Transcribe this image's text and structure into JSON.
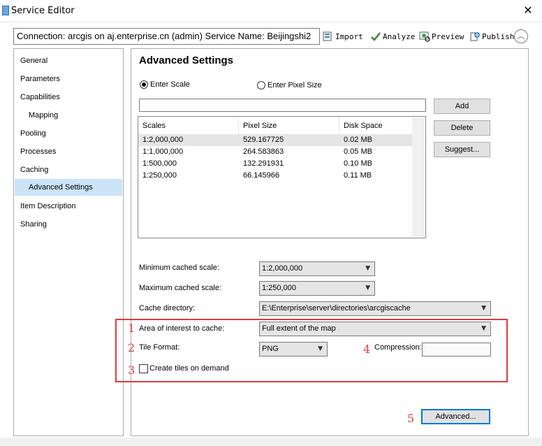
{
  "window": {
    "title": "Service Editor",
    "close_glyph": "✕"
  },
  "toolbar": {
    "connection_text": "Connection: arcgis on aj.enterprise.cn (admin)   Service Name: Beijingshi2",
    "import_label": "Import",
    "analyze_label": "Analyze",
    "preview_label": "Preview",
    "publish_label": "Publish",
    "collapse_glyph": "︿"
  },
  "sidebar": {
    "items": [
      {
        "label": "General"
      },
      {
        "label": "Parameters"
      },
      {
        "label": "Capabilities"
      },
      {
        "label": "Mapping"
      },
      {
        "label": "Pooling"
      },
      {
        "label": "Processes"
      },
      {
        "label": "Caching"
      },
      {
        "label": "Advanced Settings"
      },
      {
        "label": "Item Description"
      },
      {
        "label": "Sharing"
      }
    ],
    "selected": "Advanced Settings"
  },
  "main": {
    "heading": "Advanced Settings",
    "radio_scale": "Enter Scale",
    "radio_pixel": "Enter Pixel Size",
    "selected_radio": "Enter Scale",
    "scale_input_value": "",
    "add_label": "Add",
    "delete_label": "Delete",
    "suggest_label": "Suggest...",
    "table": {
      "headers": [
        "Scales",
        "Pixel Size",
        "Disk Space"
      ],
      "rows": [
        [
          "1:2,000,000",
          "529.167725",
          "0.02 MB"
        ],
        [
          "1:1,000,000",
          "264.583863",
          "0.05 MB"
        ],
        [
          "1:500,000",
          "132.291931",
          "0.10 MB"
        ],
        [
          "1:250,000",
          "66.145966",
          "0.11 MB"
        ]
      ]
    },
    "min_scale_label": "Minimum cached scale:",
    "min_scale_value": "1:2,000,000",
    "max_scale_label": "Maximum cached scale:",
    "max_scale_value": "1:250,000",
    "cache_dir_label": "Cache directory:",
    "cache_dir_value": "E:\\Enterprise\\server\\directories\\arcgiscache",
    "aoi_label": "Area of interest to cache:",
    "aoi_value": "Full extent of the map",
    "tile_format_label": "Tile Format:",
    "tile_format_value": "PNG",
    "compression_label": "Compression:",
    "compression_value": "",
    "create_on_demand_label": "Create tiles on demand",
    "create_on_demand_checked": false,
    "advanced_label": "Advanced...",
    "combo_arrow": "▼"
  },
  "annotations": {
    "n1": "1",
    "n2": "2",
    "n3": "3",
    "n4": "4",
    "n5": "5",
    "color": "#e03c3c"
  },
  "icons": {
    "import": "import-icon",
    "analyze": "checkmark-icon",
    "preview": "preview-icon",
    "publish": "publish-icon"
  }
}
